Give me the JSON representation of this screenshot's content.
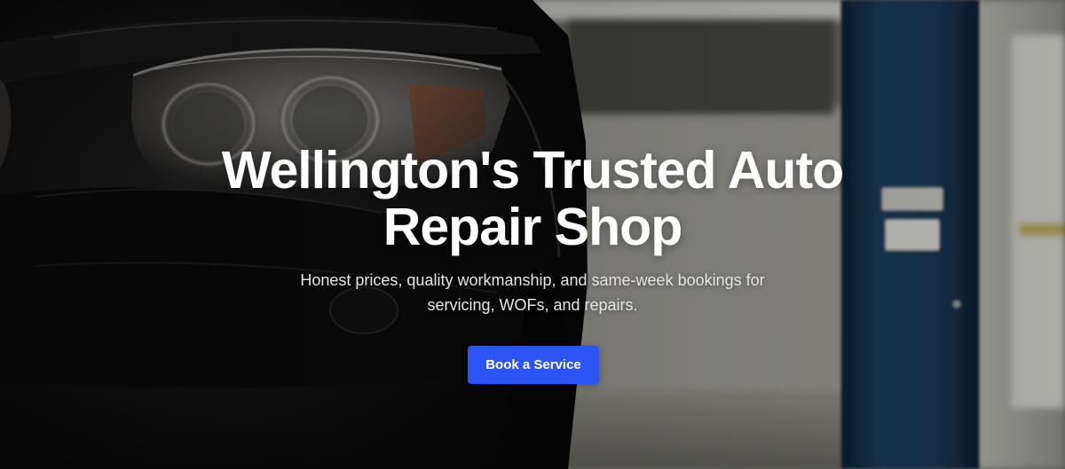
{
  "hero": {
    "title": "Wellington's Trusted Auto Repair Shop",
    "subtitle": "Honest prices, quality workmanship, and same-week bookings for servicing, WOFs, and repairs.",
    "cta_label": "Book a Service",
    "background_image": "car-headlight-garage-photo",
    "accent_color": "#2c54f5",
    "text_color": "#ffffff"
  }
}
